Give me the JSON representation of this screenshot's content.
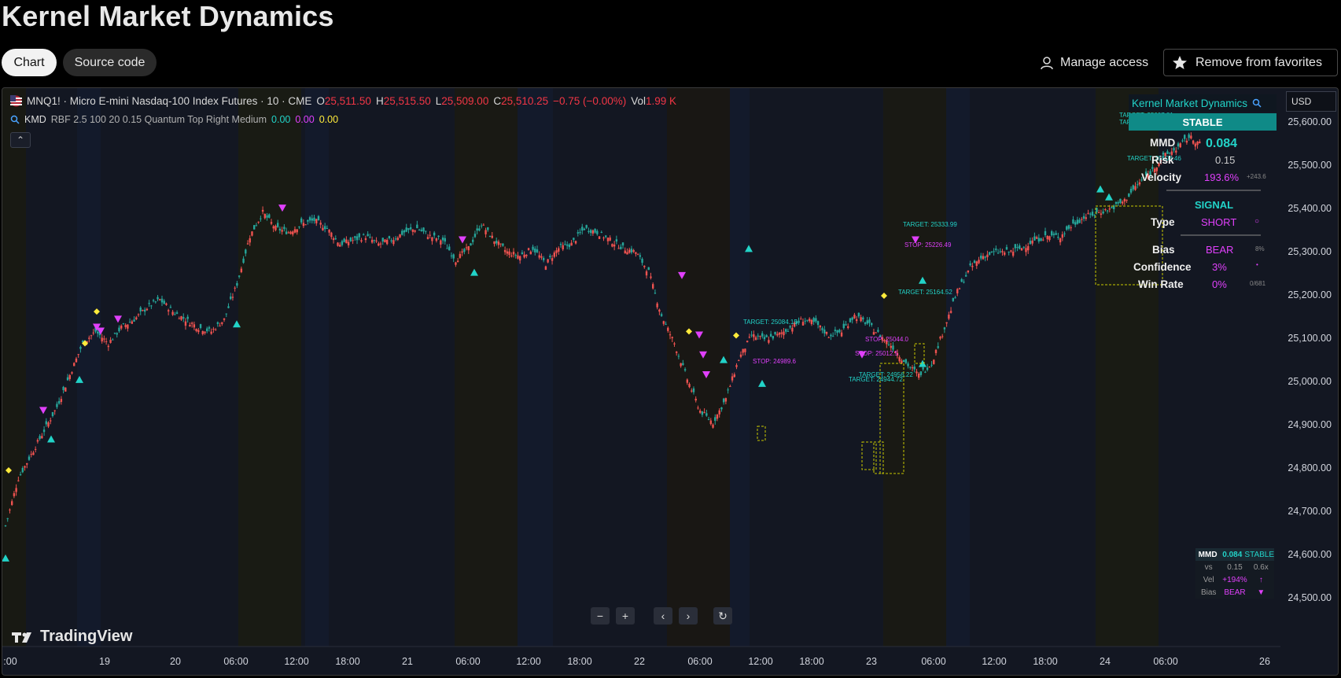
{
  "page": {
    "title": "Kernel Market Dynamics",
    "tabs": [
      "Chart",
      "Source code"
    ],
    "manage_access": "Manage access",
    "remove_favorites": "Remove from favorites"
  },
  "legend": {
    "symbol": "MNQ1! · Micro E-mini Nasdaq-100 Index Futures · 10 · CME",
    "o_label": "O",
    "o": "25,511.50",
    "h_label": "H",
    "h": "25,515.50",
    "l_label": "L",
    "l": "25,509.00",
    "c_label": "C",
    "c": "25,510.25",
    "change": "−0.75 (−0.00%)",
    "vol_label": "Vol",
    "vol": "1.99 K",
    "indicator_name": "KMD",
    "indicator_params": "RBF 2.5 100 20 0.15 Quantum Top Right Medium",
    "ind_v1": "0.00",
    "ind_v2": "0.00",
    "ind_v3": "0.00"
  },
  "currency": "USD",
  "brand": "TradingView",
  "panel": {
    "title": "Kernel Market Dynamics",
    "status": "STABLE",
    "rows": [
      {
        "label": "MMD",
        "value": "0.084"
      },
      {
        "label": "Risk",
        "value": "0.15"
      },
      {
        "label": "Velocity",
        "value": "193.6%"
      }
    ],
    "signal_label": "SIGNAL",
    "type_label": "Type",
    "type_value": "SHORT",
    "bias_label": "Bias",
    "bias_value": "BEAR",
    "bias_extra": "8%",
    "confidence_label": "Confidence",
    "confidence_value": "3%",
    "winrate_label": "Win Rate",
    "winrate_value": "0%",
    "winrate_extra": "0/681",
    "side_small": "+243.6"
  },
  "mini_table": {
    "rows": [
      [
        "MMD",
        "0.084",
        "STABLE"
      ],
      [
        "vs",
        "0.15",
        "0.6x"
      ],
      [
        "Vel",
        "+194%",
        "↑"
      ],
      [
        "Bias",
        "BEAR",
        "▼"
      ]
    ]
  },
  "colors": {
    "background": "#131722",
    "up": "#26a69a",
    "down": "#ef5350",
    "teal": "#22d3c8",
    "magenta": "#e040fb",
    "yellow": "#ffeb3b"
  },
  "chart_data": {
    "type": "line",
    "title": "",
    "x_tick_labels": [
      ":00",
      "19",
      "20",
      "06:00",
      "12:00",
      "18:00",
      "21",
      "06:00",
      "12:00",
      "18:00",
      "22",
      "06:00",
      "12:00",
      "18:00",
      "23",
      "06:00",
      "12:00",
      "18:00",
      "24",
      "06:00",
      "26"
    ],
    "y_tick_labels": [
      "25,600.00",
      "25,500.00",
      "25,400.00",
      "25,300.00",
      "25,200.00",
      "25,100.00",
      "25,000.00",
      "24,900.00",
      "24,800.00",
      "24,700.00",
      "24,600.00",
      "24,500.00"
    ],
    "ylim": [
      24470,
      25640
    ],
    "series": [
      {
        "values": [
          24580,
          24700,
          24760,
          24820,
          24880,
          24960,
          25040,
          25070,
          25040,
          25080,
          25100,
          25130,
          25150,
          25120,
          25100,
          25080,
          25070,
          25100,
          25190,
          25310,
          25370,
          25330,
          25320,
          25340,
          25350,
          25330,
          25290,
          25300,
          25310,
          25290,
          25300,
          25320,
          25330,
          25310,
          25300,
          25250,
          25280,
          25340,
          25300,
          25270,
          25260,
          25280,
          25240,
          25280,
          25290,
          25330,
          25320,
          25300,
          25280,
          25270,
          25220,
          25110,
          25040,
          24950,
          24870,
          24840,
          24900,
          25000,
          25060,
          25050,
          25060,
          25080,
          25100,
          25090,
          25060,
          25070,
          25110,
          25090,
          25060,
          25030,
          24990,
          24960,
          24990,
          25080,
          25170,
          25230,
          25260,
          25270,
          25270,
          25280,
          25300,
          25310,
          25310,
          25340,
          25360,
          25370,
          25380,
          25400,
          25440,
          25470,
          25510,
          25530,
          25560,
          25540
        ]
      }
    ],
    "buy_signal_y": [
      24520,
      24820,
      24970,
      25110,
      25240,
      25300,
      25020,
      24960,
      25010,
      25220,
      25450,
      25430
    ],
    "sell_signal_y": [
      24850,
      25060,
      25080,
      25050,
      25360,
      25280,
      25190,
      25040,
      24990,
      24940,
      24990,
      25280
    ],
    "neutral_signal_y": [
      24720,
      25040,
      25120,
      25070,
      25060,
      25160
    ],
    "target_labels": [
      "TARGET: 25084.15",
      "TARGET: 25333.99",
      "TARGET: 25164.52",
      "TARGET: 24944.72",
      "TARGET: 24956.22",
      "TARGET: 25607.81",
      "TARGET: 25593.71",
      "TARGET: 25508.46"
    ],
    "stop_labels": [
      "STOP: 24989.6",
      "STOP: 25044.0",
      "STOP: 25012.5",
      "STOP: 25226.49"
    ],
    "grid": false
  }
}
